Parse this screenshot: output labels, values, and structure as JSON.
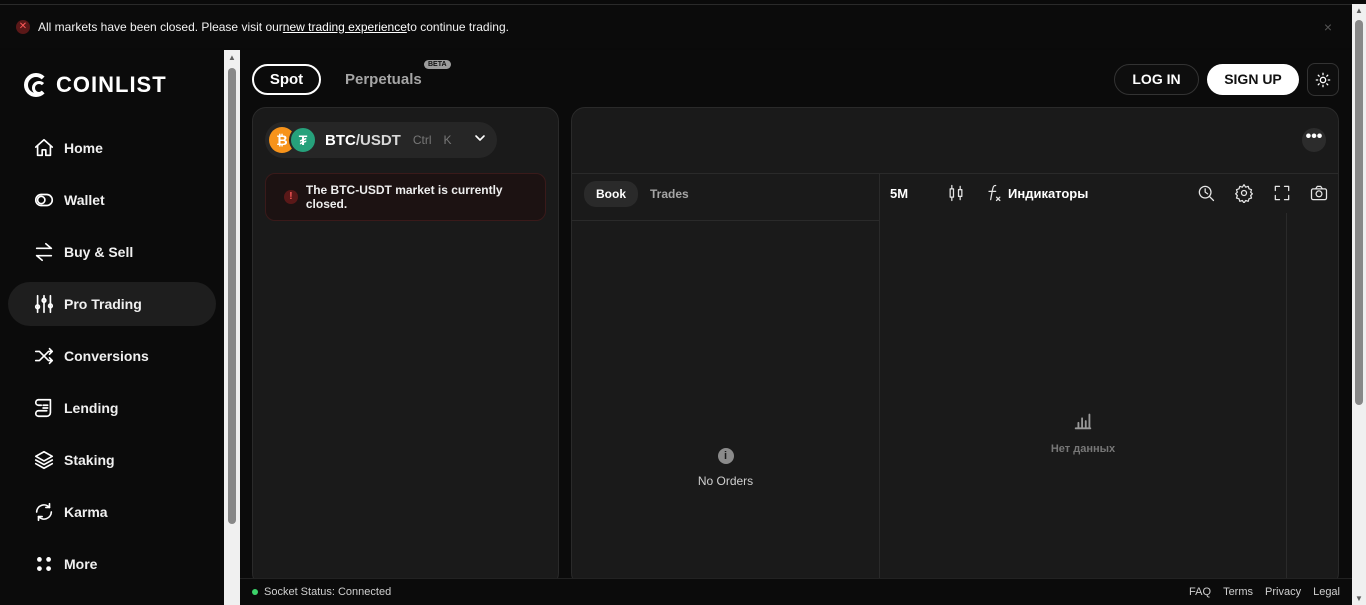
{
  "banner": {
    "text_before": "All markets have been closed. Please visit our ",
    "link_text": "new trading experience",
    "text_after": " to continue trading.",
    "close_icon": "×"
  },
  "sidebar": {
    "logo_text": "COINLIST",
    "items": [
      {
        "label": "Home",
        "icon": "home-icon"
      },
      {
        "label": "Wallet",
        "icon": "wallet-icon"
      },
      {
        "label": "Buy & Sell",
        "icon": "buy-sell-icon"
      },
      {
        "label": "Pro Trading",
        "icon": "sliders-icon",
        "active": true
      },
      {
        "label": "Conversions",
        "icon": "shuffle-icon"
      },
      {
        "label": "Lending",
        "icon": "scroll-icon"
      },
      {
        "label": "Staking",
        "icon": "layers-icon"
      },
      {
        "label": "Karma",
        "icon": "refresh-icon"
      },
      {
        "label": "More",
        "icon": "grid-dots-icon"
      }
    ]
  },
  "header": {
    "tab_spot": "Spot",
    "tab_perpetuals": "Perpetuals",
    "beta_badge": "BETA",
    "login_label": "LOG IN",
    "signup_label": "SIGN UP"
  },
  "market": {
    "base": "BTC",
    "quote": "/USDT",
    "shortcut_mod": "Ctrl",
    "shortcut_key": "K",
    "closed_message": "The BTC-USDT market is currently closed."
  },
  "orderbook": {
    "tabs": [
      "Book",
      "Trades"
    ],
    "active_tab": "Book",
    "empty_text": "No Orders"
  },
  "chart": {
    "timeframe": "5M",
    "indicators_label": "Индикаторы",
    "empty_text": "Нет данных"
  },
  "footer": {
    "socket_status": "Socket Status: Connected",
    "links": [
      "FAQ",
      "Terms",
      "Privacy",
      "Legal"
    ]
  },
  "colors": {
    "background": "#0b0b0b",
    "panel": "#1a1a1a",
    "bitcoin": "#f7931a",
    "tether": "#26a17b",
    "status_ok": "#3cd36a",
    "error": "#ff5a5a"
  }
}
